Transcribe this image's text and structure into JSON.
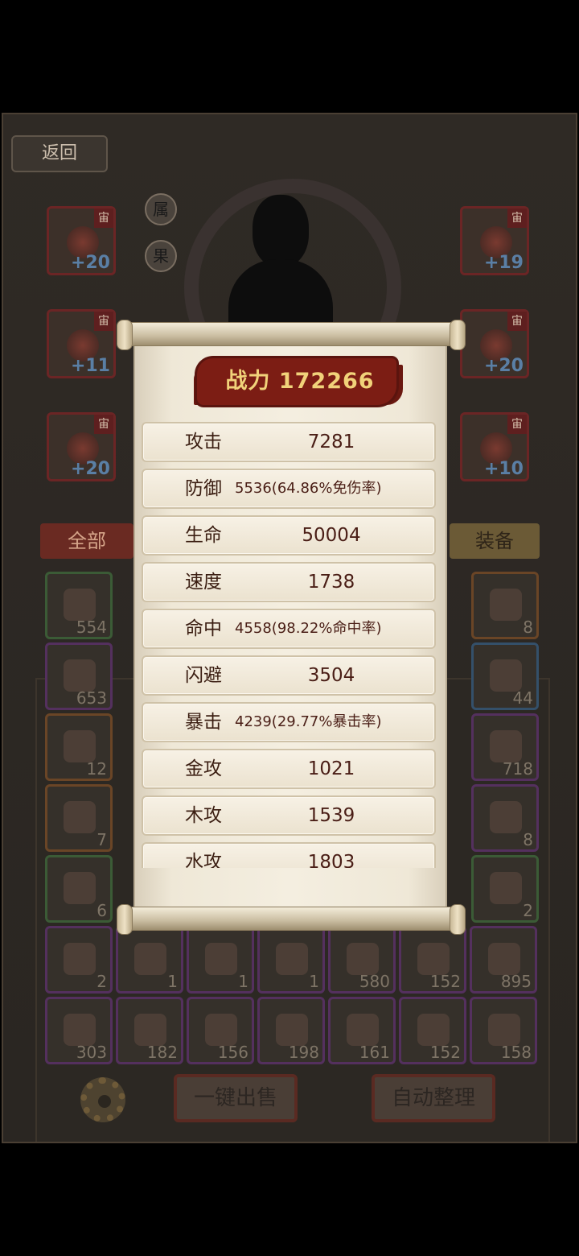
{
  "background": {
    "back_label": "返回",
    "side_buttons": [
      "属",
      "果"
    ],
    "equip_slots": [
      {
        "badge": "宙",
        "level": "+20"
      },
      {
        "badge": "宙",
        "level": "+19"
      },
      {
        "badge": "宙",
        "level": "+11"
      },
      {
        "badge": "宙",
        "level": "+20"
      },
      {
        "badge": "宙",
        "level": "+20"
      },
      {
        "badge": "宙",
        "level": "+10"
      }
    ],
    "tab_all": "全部",
    "tab_equip": "装备",
    "inventory_counts": [
      "554",
      "8",
      "653",
      "44",
      "12",
      "718",
      "7",
      "8",
      "6",
      "2",
      "2",
      "1",
      "1",
      "1",
      "580",
      "152",
      "895",
      "303",
      "182",
      "156",
      "198",
      "161",
      "152",
      "158"
    ],
    "one_key_sell": "一键出售",
    "auto_sort": "自动整理"
  },
  "popup": {
    "power_label": "战力 172266",
    "stats": [
      {
        "label": "攻击",
        "value": "7281"
      },
      {
        "label": "防御",
        "value": "5536(64.86%免伤率)"
      },
      {
        "label": "生命",
        "value": "50004"
      },
      {
        "label": "速度",
        "value": "1738"
      },
      {
        "label": "命中",
        "value": "4558(98.22%命中率)"
      },
      {
        "label": "闪避",
        "value": "3504"
      },
      {
        "label": "暴击",
        "value": "4239(29.77%暴击率)"
      },
      {
        "label": "金攻",
        "value": "1021"
      },
      {
        "label": "木攻",
        "value": "1539"
      },
      {
        "label": "水攻",
        "value": "1803"
      }
    ]
  }
}
